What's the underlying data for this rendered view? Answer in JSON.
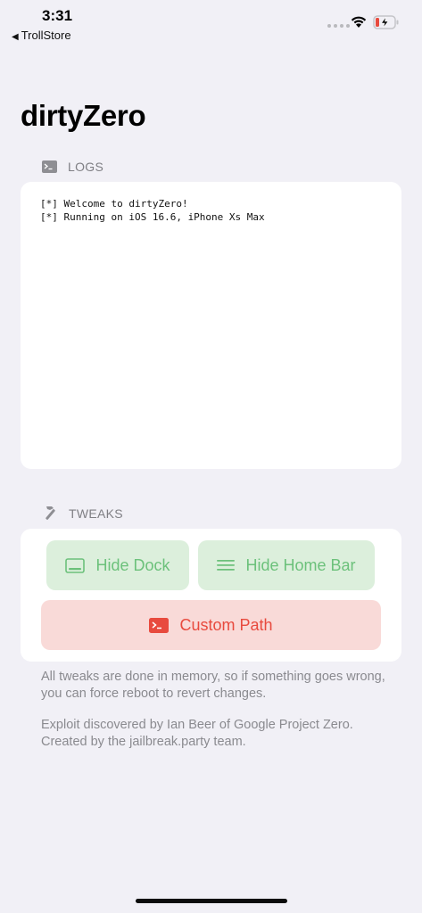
{
  "status_bar": {
    "time": "3:31",
    "back_label": "TrollStore",
    "back_arrow": "◀"
  },
  "title": "dirtyZero",
  "logs": {
    "header": "LOGS",
    "icon": "terminal-icon",
    "lines": [
      "[*] Welcome to dirtyZero!",
      "[*] Running on iOS 16.6, iPhone Xs Max"
    ]
  },
  "tweaks": {
    "header": "TWEAKS",
    "icon": "hammer-icon",
    "buttons": {
      "hide_dock": "Hide Dock",
      "hide_home_bar": "Hide Home Bar",
      "custom_path": "Custom Path"
    }
  },
  "footer": {
    "note": "All tweaks are done in memory, so if something goes wrong, you can force reboot to revert changes.",
    "credits": "Exploit discovered by Ian Beer of Google Project Zero. Created by the jailbreak.party team."
  },
  "colors": {
    "background": "#f1f0f6",
    "green_button_bg": "#dcefdc",
    "green_button_text": "#6cc17b",
    "red_button_bg": "#f9dad8",
    "red_button_text": "#e84a3e",
    "battery_charging": "#e84a3e"
  }
}
